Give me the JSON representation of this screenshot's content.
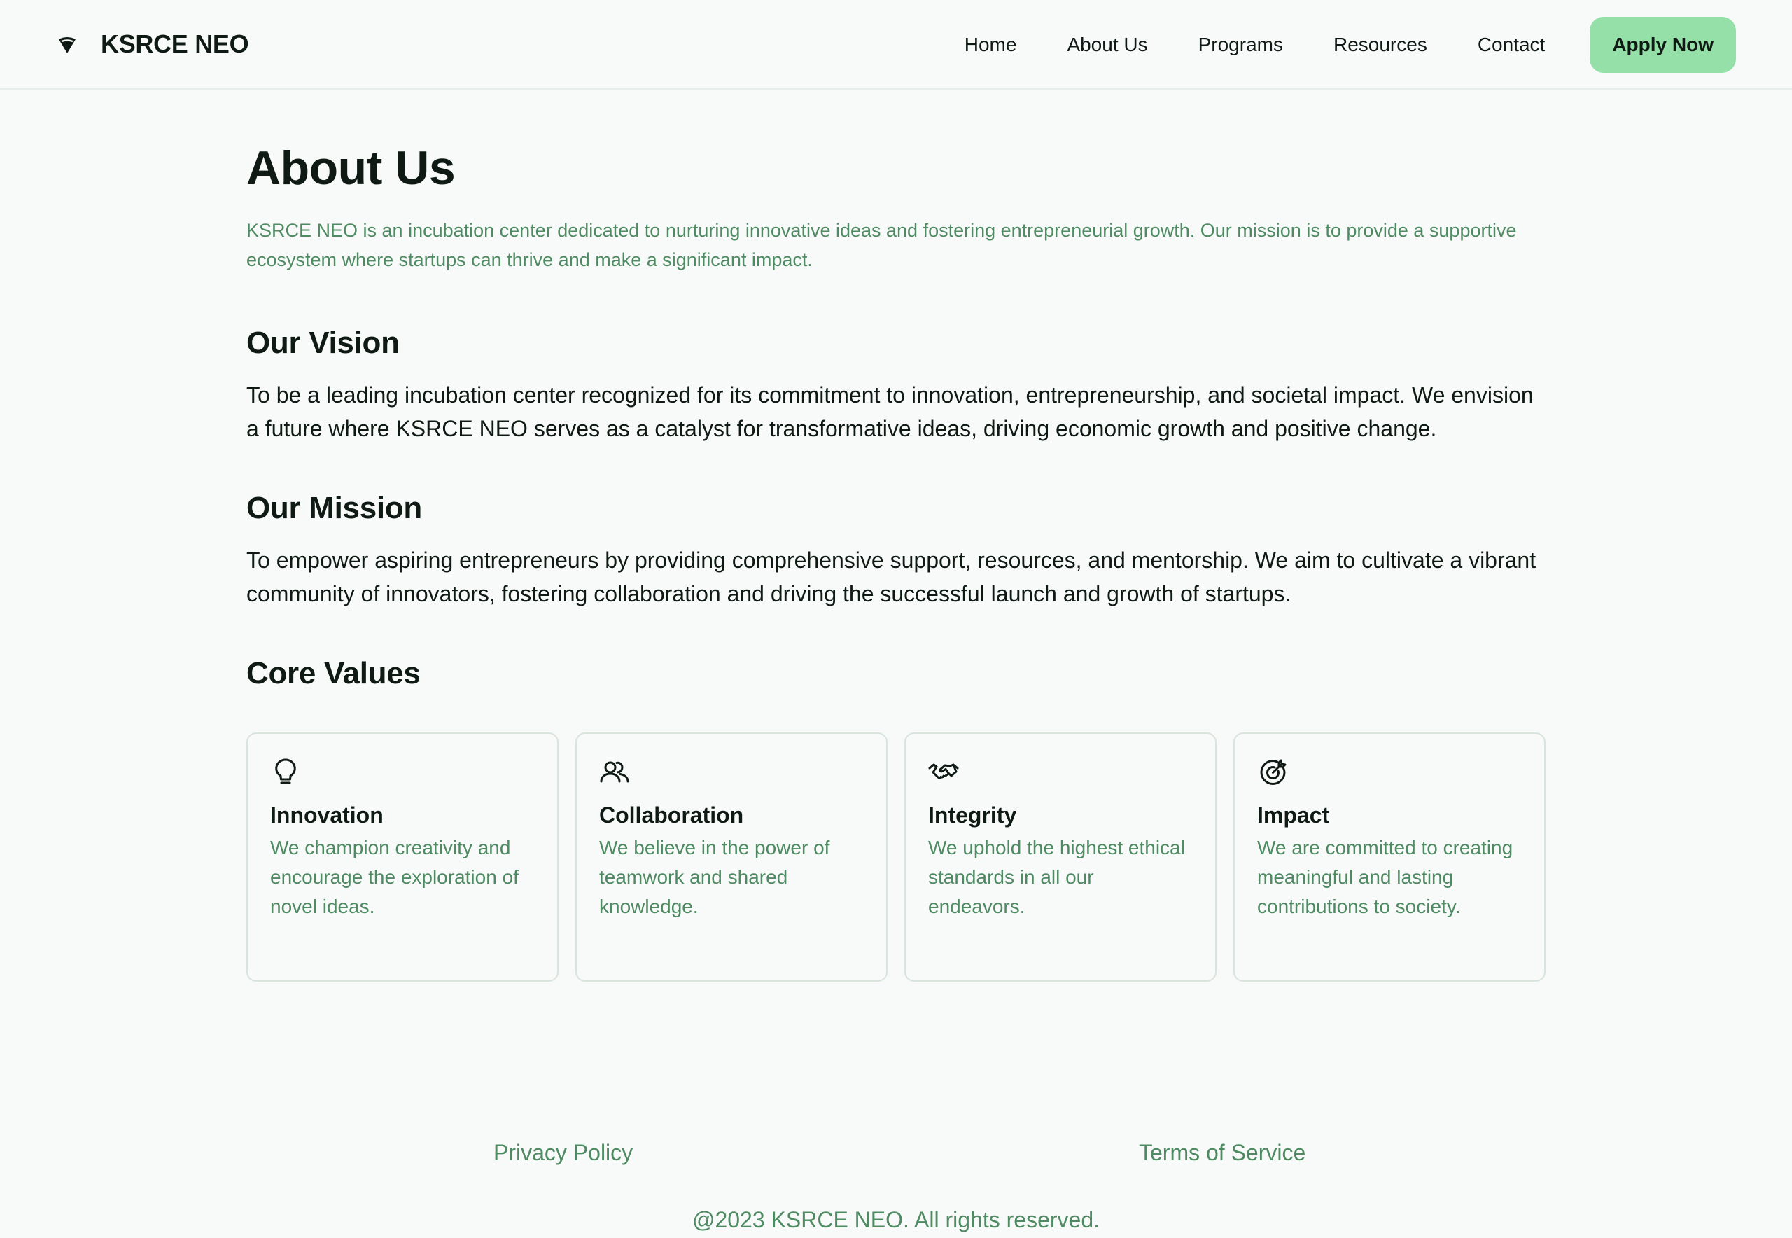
{
  "header": {
    "brand_name": "KSRCE NEO",
    "brand_icon": "logo-icon",
    "nav": [
      {
        "label": "Home"
      },
      {
        "label": "About Us"
      },
      {
        "label": "Programs"
      },
      {
        "label": "Resources"
      },
      {
        "label": "Contact"
      }
    ],
    "apply_label": "Apply Now"
  },
  "colors": {
    "accent": "#94e0a8",
    "muted_text": "#4e8a62",
    "background": "#f8faf9",
    "text": "#0f1a14"
  },
  "main": {
    "title": "About Us",
    "intro": "KSRCE NEO is an incubation center dedicated to nurturing innovative ideas and fostering entrepreneurial growth. Our mission is to provide a supportive ecosystem where startups can thrive and make a significant impact.",
    "vision": {
      "title": "Our Vision",
      "body": "To be a leading incubation center recognized for its commitment to innovation, entrepreneurship, and societal impact. We envision a future where KSRCE NEO serves as a catalyst for transformative ideas, driving economic growth and positive change."
    },
    "mission": {
      "title": "Our Mission",
      "body": "To empower aspiring entrepreneurs by providing comprehensive support, resources, and mentorship. We aim to cultivate a vibrant community of innovators, fostering collaboration and driving the successful launch and growth of startups."
    },
    "values": {
      "title": "Core Values",
      "cards": [
        {
          "icon": "lightbulb-icon",
          "title": "Innovation",
          "text": "We champion creativity and encourage the exploration of novel ideas."
        },
        {
          "icon": "users-icon",
          "title": "Collaboration",
          "text": "We believe in the power of teamwork and shared knowledge."
        },
        {
          "icon": "handshake-icon",
          "title": "Integrity",
          "text": "We uphold the highest ethical standards in all our endeavors."
        },
        {
          "icon": "target-icon",
          "title": "Impact",
          "text": "We are committed to creating meaningful and lasting contributions to society."
        }
      ]
    }
  },
  "footer": {
    "privacy_label": "Privacy Policy",
    "terms_label": "Terms of Service",
    "copyright": "@2023 KSRCE NEO. All rights reserved."
  }
}
